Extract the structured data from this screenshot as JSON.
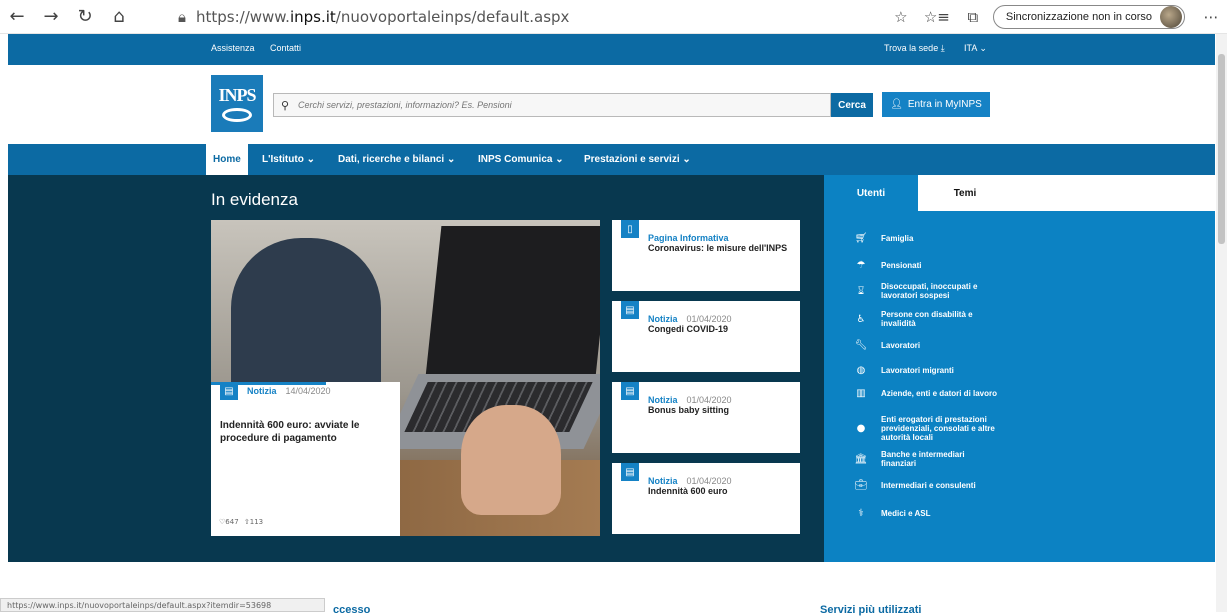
{
  "browser": {
    "url_prefix": "https://www.",
    "url_domain": "inps.it",
    "url_path": "/nuovoportaleinps/default.aspx",
    "sync_label": "Sincronizzazione non in corso",
    "status_url": "https://www.inps.it/nuovoportaleinps/default.aspx?itemdir=53698"
  },
  "topbar": {
    "assistenza": "Assistenza",
    "contatti": "Contatti",
    "trova_sede": "Trova la sede",
    "lang": "ITA"
  },
  "header": {
    "logo_text": "INPS",
    "search_placeholder": "Cerchi servizi, prestazioni, informazioni? Es. Pensioni",
    "search_button": "Cerca",
    "myinps_button": "Entra in MyINPS"
  },
  "nav": {
    "items": [
      "Home",
      "L'Istituto",
      "Dati, ricerche e bilanci",
      "INPS Comunica",
      "Prestazioni e servizi"
    ]
  },
  "evidenza": {
    "title": "In evidenza",
    "feature": {
      "tag": "Notizia",
      "date": "14/04/2020",
      "title": "Indennità 600 euro: avviate le procedure di pagamento",
      "likes": "647",
      "shares": "113"
    },
    "cards": [
      {
        "tag": "Pagina Informativa",
        "date": "",
        "title": "Coronavirus: le misure dell'INPS"
      },
      {
        "tag": "Notizia",
        "date": "01/04/2020",
        "title": "Congedi COVID-19"
      },
      {
        "tag": "Notizia",
        "date": "01/04/2020",
        "title": "Bonus baby sitting"
      },
      {
        "tag": "Notizia",
        "date": "01/04/2020",
        "title": "Indennità 600 euro"
      }
    ]
  },
  "right_panel": {
    "tabs": [
      "Utenti",
      "Temi"
    ],
    "items": [
      {
        "label": "Famiglia",
        "icon": "stroller-icon"
      },
      {
        "label": "Pensionati",
        "icon": "umbrella-icon"
      },
      {
        "label": "Disoccupati, inoccupati e lavoratori sospesi",
        "icon": "hourglass-icon"
      },
      {
        "label": "Persone con disabilità e invalidità",
        "icon": "wheelchair-icon"
      },
      {
        "label": "Lavoratori",
        "icon": "wrench-icon"
      },
      {
        "label": "Lavoratori migranti",
        "icon": "globe-icon"
      },
      {
        "label": "Aziende, enti e datori di lavoro",
        "icon": "building-icon"
      },
      {
        "label": "Enti erogatori di prestazioni previdenziali, consolati e altre autorità locali",
        "icon": "piggybank-icon"
      },
      {
        "label": "Banche e intermediari finanziari",
        "icon": "bank-icon"
      },
      {
        "label": "Intermediari e consulenti",
        "icon": "briefcase-icon"
      },
      {
        "label": "Medici e ASL",
        "icon": "stethoscope-icon"
      }
    ]
  },
  "below": {
    "left_title_fragment": "ccesso",
    "right_title": "Servizi più utilizzati"
  }
}
